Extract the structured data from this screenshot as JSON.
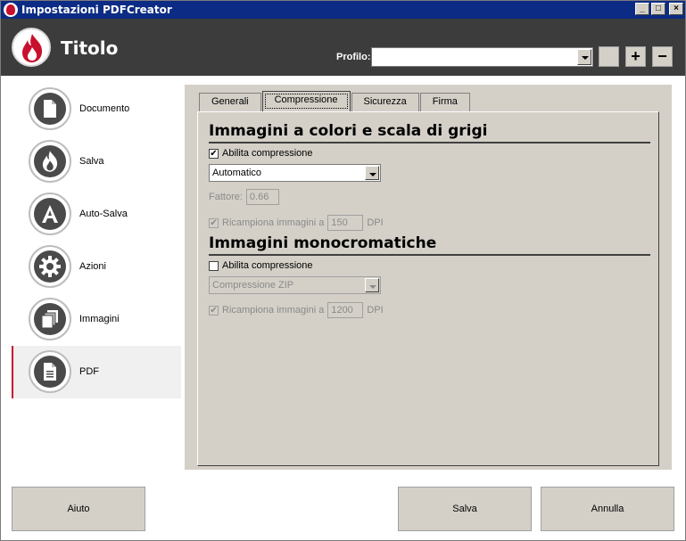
{
  "window": {
    "title": "Impostazioni PDFCreator"
  },
  "header": {
    "title": "Titolo",
    "profile_label": "Profilo:",
    "profile_value": "",
    "add_symbol": "+",
    "remove_symbol": "−"
  },
  "sidebar": {
    "items": [
      {
        "label": "Documento",
        "icon": "document-icon",
        "active": false
      },
      {
        "label": "Salva",
        "icon": "flame-icon",
        "active": false
      },
      {
        "label": "Auto-Salva",
        "icon": "letter-a-icon",
        "active": false
      },
      {
        "label": "Azioni",
        "icon": "gear-icon",
        "active": false
      },
      {
        "label": "Immagini",
        "icon": "images-icon",
        "active": false
      },
      {
        "label": "PDF",
        "icon": "pdf-document-icon",
        "active": true
      }
    ]
  },
  "tabs": [
    {
      "label": "Generali",
      "active": false
    },
    {
      "label": "Compressione",
      "active": true
    },
    {
      "label": "Sicurezza",
      "active": false
    },
    {
      "label": "Firma",
      "active": false
    }
  ],
  "color_section": {
    "title": "Immagini a colori e scala di grigi",
    "enable_label": "Abilita compressione",
    "enable_checked": true,
    "method": "Automatico",
    "factor_label": "Fattore:",
    "factor_value": "0.66",
    "resample_label": "Ricampiona immagini a",
    "resample_checked": true,
    "resample_value": "150",
    "resample_unit": "DPI"
  },
  "mono_section": {
    "title": "Immagini monocromatiche",
    "enable_label": "Abilita compressione",
    "enable_checked": false,
    "method": "Compressione ZIP",
    "resample_label": "Ricampiona immagini a",
    "resample_checked": true,
    "resample_value": "1200",
    "resample_unit": "DPI"
  },
  "buttons": {
    "help": "Aiuto",
    "save": "Salva",
    "cancel": "Annulla"
  },
  "colors": {
    "accent": "#c8102e",
    "header_bg": "#3c3c3c",
    "titlebar_bg": "#0b2b84"
  }
}
